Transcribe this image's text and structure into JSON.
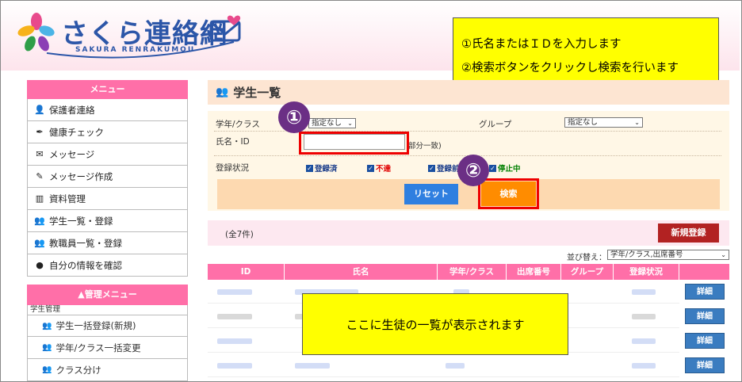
{
  "header": {
    "logo_title": "さくら連絡網",
    "logo_sub": "SAKURA RENRAKUMOU"
  },
  "notes": {
    "top_line1": "①氏名またはＩＤを入力します",
    "top_line2": "②検索ボタンをクリックし検索を行います",
    "bottom": "ここに生徒の一覧が表示されます"
  },
  "sidebar": {
    "title": "メニュー",
    "items": [
      {
        "label": "保護者連絡",
        "icon": "person-phone-icon"
      },
      {
        "label": "健康チェック",
        "icon": "pen-icon"
      },
      {
        "label": "メッセージ",
        "icon": "envelope-open-icon"
      },
      {
        "label": "メッセージ作成",
        "icon": "compose-icon"
      },
      {
        "label": "資料管理",
        "icon": "books-icon"
      },
      {
        "label": "学生一覧・登録",
        "icon": "students-icon"
      },
      {
        "label": "教職員一覧・登録",
        "icon": "staff-icon"
      },
      {
        "label": "自分の情報を確認",
        "icon": "speech-bubble-icon"
      }
    ]
  },
  "admin_menu": {
    "title": "▲管理メニュー",
    "section": "学生管理",
    "items": [
      {
        "label": "学生一括登録(新規)"
      },
      {
        "label": "学年/クラス一括変更"
      },
      {
        "label": "クラス分け"
      }
    ]
  },
  "main": {
    "title": "学生一覧"
  },
  "search": {
    "grade_label": "学年/クラス",
    "grade_value": "指定なし",
    "group_label": "グループ",
    "group_value": "指定なし",
    "name_label": "氏名・ID",
    "name_value": "",
    "partial_match": "部分一致)",
    "status_label": "登録状況",
    "statuses": [
      {
        "label": "登録済",
        "color": "#1a3c8a"
      },
      {
        "label": "不達",
        "color": "#e00000"
      },
      {
        "label": "登録前",
        "color": "#1a3c8a"
      },
      {
        "label": "停止中",
        "color": "#008000"
      }
    ],
    "reset_label": "リセット",
    "search_label": "検索"
  },
  "markers": {
    "one": "①",
    "two": "②"
  },
  "list": {
    "count": "(全7件)",
    "new_label": "新規登録",
    "sort_label": "並び替え：",
    "sort_value": "学年/クラス,出席番号",
    "columns": [
      "ID",
      "氏名",
      "学年/クラス",
      "出席番号",
      "グループ",
      "登録状況"
    ],
    "detail_label": "詳細"
  },
  "colors": {
    "accent_pink": "#ff6fa8",
    "highlight_red": "#e00000",
    "note_yellow": "#ffff00",
    "marker_purple": "#6b2f85"
  }
}
